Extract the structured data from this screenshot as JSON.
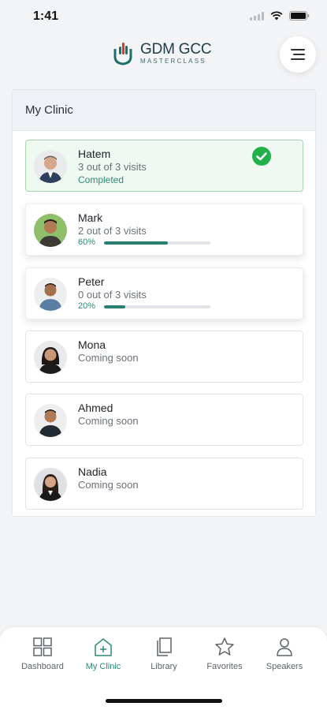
{
  "status": {
    "time": "1:41"
  },
  "brand": {
    "title": "GDM GCC",
    "subtitle": "MASTERCLASS"
  },
  "panel": {
    "title": "My Clinic"
  },
  "patients": [
    {
      "name": "Hatem",
      "visits": "3 out of 3 visits",
      "status": "Completed"
    },
    {
      "name": "Mark",
      "visits": "2 out of 3 visits",
      "progress_label": "60%",
      "progress": 0.6
    },
    {
      "name": "Peter",
      "visits": "0 out of 3 visits",
      "progress_label": "20%",
      "progress": 0.2
    },
    {
      "name": "Mona",
      "status": "Coming soon"
    },
    {
      "name": "Ahmed",
      "status": "Coming soon"
    },
    {
      "name": "Nadia",
      "status": "Coming soon"
    }
  ],
  "nav": {
    "items": [
      {
        "label": "Dashboard",
        "icon": "dashboard-icon"
      },
      {
        "label": "My Clinic",
        "icon": "clinic-icon",
        "active": true
      },
      {
        "label": "Library",
        "icon": "library-icon"
      },
      {
        "label": "Favorites",
        "icon": "star-icon"
      },
      {
        "label": "Speakers",
        "icon": "person-icon"
      }
    ]
  },
  "colors": {
    "accent": "#2a7f72",
    "completed_bg": "#eff8f1",
    "check": "#22b04b"
  }
}
